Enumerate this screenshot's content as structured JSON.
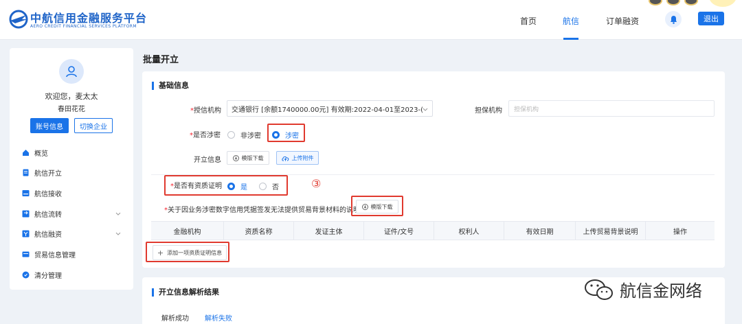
{
  "header": {
    "logo_cn": "中航信用金融服务平台",
    "logo_en": "AERO CREDIT FINANCIAL SERVICES PLATFORM",
    "nav": [
      {
        "label": "首页"
      },
      {
        "label": "航信"
      },
      {
        "label": "订单融资"
      }
    ],
    "active_nav": "航信",
    "logout_label": "退出",
    "brand_color": "#1a73e8"
  },
  "sidebar": {
    "welcome": "欢迎您，麦太太",
    "company": "春田花花",
    "account_button": "账号信息",
    "switch_button": "切换企业",
    "items": [
      {
        "label": "概览",
        "icon": "home-icon"
      },
      {
        "label": "航信开立",
        "icon": "document-icon"
      },
      {
        "label": "航信接收",
        "icon": "inbox-icon"
      },
      {
        "label": "航信流转",
        "icon": "transfer-icon"
      },
      {
        "label": "航信融资",
        "icon": "finance-icon"
      },
      {
        "label": "贸易信息管理",
        "icon": "trade-icon"
      },
      {
        "label": "清分管理",
        "icon": "settle-icon"
      }
    ]
  },
  "main": {
    "page_title": "批量开立",
    "basic_section": "基础信息",
    "credit_org_label": "授信机构",
    "credit_org_value": "交通银行 [余额1740000.00元] 有效期:2022-04-01至2023-(",
    "guarantee_label": "担保机构",
    "guarantee_placeholder": "担保机构",
    "secret_label": "是否涉密",
    "secret_options": [
      "非涉密",
      "涉密"
    ],
    "secret_selected": "涉密",
    "open_info_label": "开立信息",
    "template_download": "模版下载",
    "upload_attachment": "上传附件",
    "qualification_label": "是否有资质证明",
    "qualification_options": [
      "是",
      "否"
    ],
    "qualification_selected": "是",
    "step_marker": "③",
    "explanation_label": "关于因业务涉密数字信用凭据签发无法提供贸易背景材料的说明",
    "explanation_download": "模版下载",
    "table_headers": [
      "金融机构",
      "资质名称",
      "发证主体",
      "证件/文号",
      "权利人",
      "有效日期",
      "上传贸易背景说明",
      "操作"
    ],
    "add_row_button": "添加一项资质证明信息",
    "result_section": "开立信息解析结果",
    "result_tabs": [
      "解析成功",
      "解析失败"
    ],
    "result_active_tab": "解析成功"
  },
  "watermark": {
    "text": "航信金网络"
  }
}
